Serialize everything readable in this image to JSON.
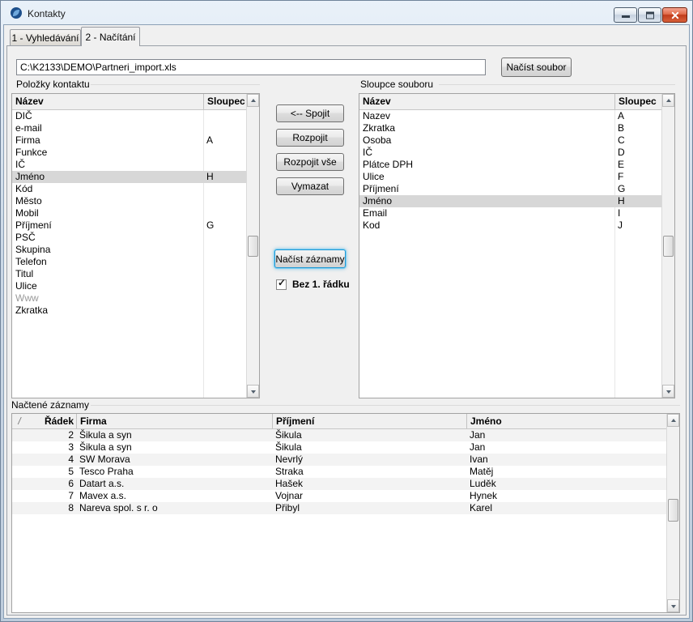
{
  "window": {
    "title": "Kontakty",
    "buttons": [
      "minimize",
      "maximize",
      "close"
    ]
  },
  "tabs": [
    {
      "label": "1 - Vyhledávání",
      "active": false
    },
    {
      "label": "2 - Načítání",
      "active": true
    }
  ],
  "file_bar": {
    "path": "C:\\K2133\\DEMO\\Partneri_import.xls",
    "load_file_button": "Načíst soubor"
  },
  "left_panel": {
    "title": "Položky kontaktu",
    "columns": [
      "Název",
      "Sloupec"
    ],
    "rows": [
      {
        "name": "DIČ",
        "col": ""
      },
      {
        "name": "e-mail",
        "col": ""
      },
      {
        "name": "Firma",
        "col": "A"
      },
      {
        "name": "Funkce",
        "col": ""
      },
      {
        "name": "IČ",
        "col": ""
      },
      {
        "name": "Jméno",
        "col": "H",
        "selected": true
      },
      {
        "name": "Kód",
        "col": ""
      },
      {
        "name": "Město",
        "col": ""
      },
      {
        "name": "Mobil",
        "col": ""
      },
      {
        "name": "Příjmení",
        "col": "G"
      },
      {
        "name": "PSČ",
        "col": ""
      },
      {
        "name": "Skupina",
        "col": ""
      },
      {
        "name": "Telefon",
        "col": ""
      },
      {
        "name": "Titul",
        "col": ""
      },
      {
        "name": "Ulice",
        "col": ""
      },
      {
        "name": "Www",
        "col": "",
        "muted": true
      },
      {
        "name": "Zkratka",
        "col": ""
      }
    ]
  },
  "actions": {
    "join": "<-- Spojit",
    "unjoin": "Rozpojit",
    "unjoin_all": "Rozpojit vše",
    "clear": "Vymazat",
    "load_records": "Načíst záznamy",
    "skip_first_row_label": "Bez 1. řádku",
    "skip_first_row_checked": true,
    "check_glyph": "✓"
  },
  "right_panel": {
    "title": "Sloupce souboru",
    "columns": [
      "Název",
      "Sloupec"
    ],
    "rows": [
      {
        "name": "Nazev",
        "col": "A"
      },
      {
        "name": "Zkratka",
        "col": "B"
      },
      {
        "name": "Osoba",
        "col": "C"
      },
      {
        "name": "IČ",
        "col": "D"
      },
      {
        "name": "Plátce DPH",
        "col": "E"
      },
      {
        "name": "Ulice",
        "col": "F"
      },
      {
        "name": "Příjmení",
        "col": "G"
      },
      {
        "name": "Jméno",
        "col": "H",
        "selected": true
      },
      {
        "name": "Email",
        "col": "I"
      },
      {
        "name": "Kod",
        "col": "J"
      }
    ]
  },
  "bottom_panel": {
    "title": "Načtené záznamy",
    "sort_glyph": "/",
    "columns": [
      "Řádek",
      "Firma",
      "Příjmení",
      "Jméno"
    ],
    "rows": [
      {
        "radek": "2",
        "firma": "Šikula a syn",
        "prijmeni": "Šikula",
        "jmeno": "Jan"
      },
      {
        "radek": "3",
        "firma": "Šikula a syn",
        "prijmeni": "Šikula",
        "jmeno": "Jan"
      },
      {
        "radek": "4",
        "firma": "SW Morava",
        "prijmeni": "Nevrlý",
        "jmeno": "Ivan"
      },
      {
        "radek": "5",
        "firma": "Tesco Praha",
        "prijmeni": "Straka",
        "jmeno": "Matěj"
      },
      {
        "radek": "6",
        "firma": "Datart a.s.",
        "prijmeni": "Hašek",
        "jmeno": "Luděk"
      },
      {
        "radek": "7",
        "firma": "Mavex a.s.",
        "prijmeni": "Vojnar",
        "jmeno": "Hynek"
      },
      {
        "radek": "8",
        "firma": "Nareva spol. s r. o",
        "prijmeni": "Přibyl",
        "jmeno": "Karel"
      }
    ]
  },
  "colors": {
    "focus_ring": "#1e97d4",
    "selection_bg": "#d7d7d7",
    "close_button": "#c03c1c"
  }
}
